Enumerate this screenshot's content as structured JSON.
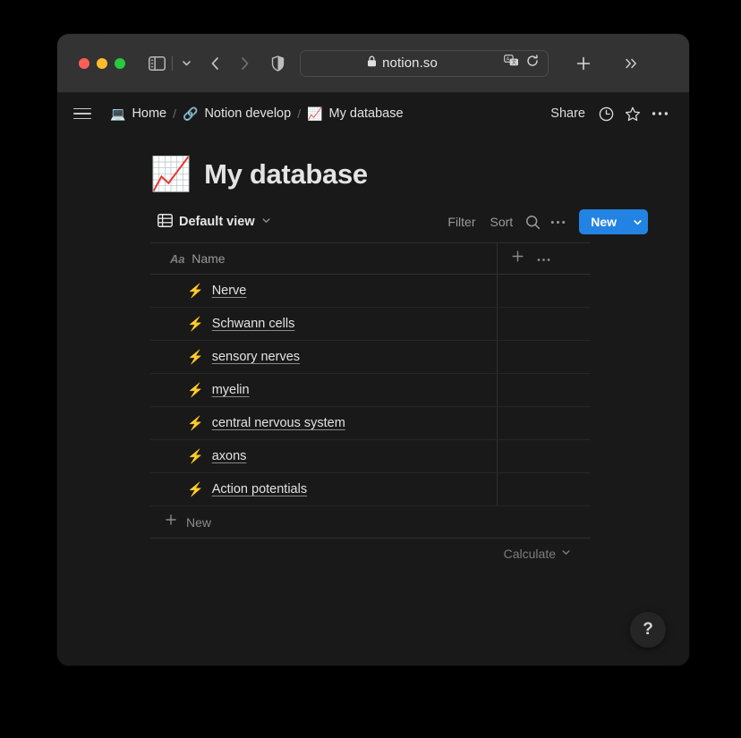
{
  "browser": {
    "traffic_lights": [
      "close",
      "minimize",
      "maximize"
    ],
    "url": "notion.so",
    "icons": {
      "sidebar_toggle": "sidebar-toggle-icon",
      "tab_overview_chevron": "chevron-down-icon",
      "back": "chevron-left-icon",
      "forward": "chevron-right-icon",
      "shield": "shield-icon",
      "lock": "lock-icon",
      "translate": "translate-icon",
      "reload": "reload-icon",
      "new_tab": "plus-icon",
      "more_tabs": "double-chevron-right-icon"
    }
  },
  "topbar": {
    "menu_icon": "hamburger-menu-icon",
    "breadcrumb": [
      {
        "emoji": "💻",
        "icon_name": "laptop-emoji",
        "label": "Home"
      },
      {
        "emoji": "🔗",
        "icon_name": "link-emoji",
        "label": "Notion develop"
      },
      {
        "emoji": "📈",
        "icon_name": "chart-increasing-emoji",
        "label": "My database"
      }
    ],
    "separator": "/",
    "share_label": "Share",
    "history_icon": "clock-icon",
    "favorite_icon": "star-icon",
    "more_icon": "ellipsis-icon"
  },
  "page": {
    "emoji": "📈",
    "emoji_name": "chart-increasing-emoji",
    "title": "My database"
  },
  "db_toolbar": {
    "view_icon": "table-grid-icon",
    "view_name": "Default view",
    "view_chevron": "chevron-down-icon",
    "filter_label": "Filter",
    "sort_label": "Sort",
    "search_icon": "search-icon",
    "more_icon": "ellipsis-icon",
    "new_label": "New",
    "new_chevron": "chevron-down-icon",
    "new_button_color": "#2383e2"
  },
  "table": {
    "columns": [
      {
        "type_icon": "Aa",
        "label": "Name"
      }
    ],
    "add_column_icon": "plus-icon",
    "column_options_icon": "ellipsis-icon",
    "row_emoji": "⚡",
    "row_emoji_name": "high-voltage-emoji",
    "rows": [
      {
        "name": "Nerve"
      },
      {
        "name": "Schwann cells"
      },
      {
        "name": "sensory nerves"
      },
      {
        "name": "myelin"
      },
      {
        "name": "central nervous system"
      },
      {
        "name": "axons"
      },
      {
        "name": "Action potentials"
      }
    ],
    "new_row_icon": "plus-icon",
    "new_row_label": "New",
    "calculate_label": "Calculate",
    "calculate_chevron": "chevron-down-icon"
  },
  "help": {
    "label": "?",
    "icon_name": "question-mark-icon"
  },
  "colors": {
    "page_background": "#191919",
    "browser_chrome": "#333333",
    "accent_blue": "#2383e2",
    "row_emoji_yellow": "#f5a623",
    "text_primary": "#e3e3e3",
    "text_secondary": "#9b9b9b",
    "border": "#2f2f2f"
  }
}
